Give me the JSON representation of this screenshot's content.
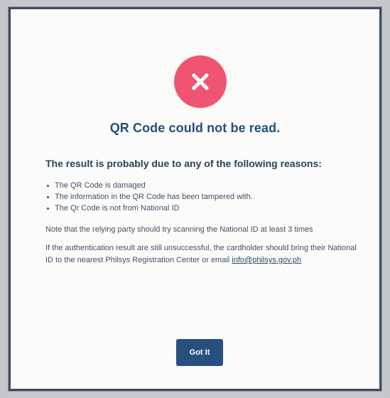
{
  "dialog": {
    "icon": "close-icon",
    "title": "QR Code could not be read.",
    "subtitle": "The result is probably due to any of the following reasons:",
    "reasons": [
      "The QR Code is damaged",
      "The information in the QR Code has been tampered with.",
      "The Qr Code is not from National ID"
    ],
    "note": "Note that the relying party should try scanning the National ID at least 3 times",
    "info_text": "If the authentication result are still unsuccessful, the cardholder should bring their National ID to the nearest Philsys Registration Center or email",
    "email": "info@philsys.gov.ph",
    "button_label": "Got It"
  },
  "colors": {
    "error_badge": "#ef5572",
    "title": "#284d7a",
    "button": "#28507f",
    "border": "#3f4b5e"
  }
}
